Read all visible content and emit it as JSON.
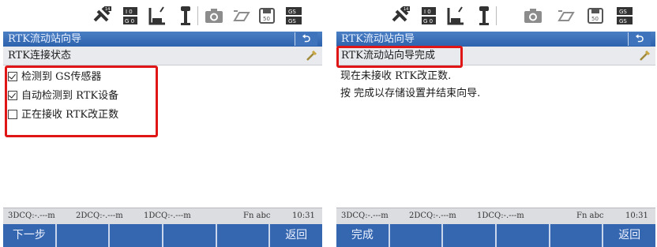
{
  "accent_color": "#3566b0",
  "highlight_color": "#e01616",
  "left_screen": {
    "status_icons": [
      "satellite-icon",
      "gs-indicator-icon",
      "rtk-signal-icon",
      "antenna-icon",
      "camera-icon",
      "storage-icon",
      "save-icon",
      "gs-gs-icon"
    ],
    "title": "RTK流动站向导",
    "back_symbol": "⮌",
    "subtitle": "RTK连接状态",
    "checklist": [
      {
        "label": "检测到 GS传感器",
        "checked": true
      },
      {
        "label": "自动检测到 RTK设备",
        "checked": true
      },
      {
        "label": "正在接收 RTK改正数",
        "checked": false
      }
    ],
    "info": {
      "dcq3": "3DCQ:-.---m",
      "dcq2": "2DCQ:-.---m",
      "dcq1": "1DCQ:-.---m",
      "mode": "Fn abc",
      "time": "10:31"
    },
    "softkeys": [
      "下一步",
      "",
      "",
      "",
      "",
      "返回"
    ]
  },
  "right_screen": {
    "title": "RTK流动站向导",
    "back_symbol": "⮌",
    "subtitle": "RTK流动站向导完成",
    "messages": [
      "现在未接收 RTK改正数.",
      "按 完成以存储设置并结束向导."
    ],
    "info": {
      "dcq3": "3DCQ:-.---m",
      "dcq2": "2DCQ:-.---m",
      "dcq1": "1DCQ:-.---m",
      "mode": "Fn abc",
      "time": "10:31"
    },
    "softkeys": [
      "完成",
      "",
      "",
      "",
      "",
      "返回"
    ]
  }
}
